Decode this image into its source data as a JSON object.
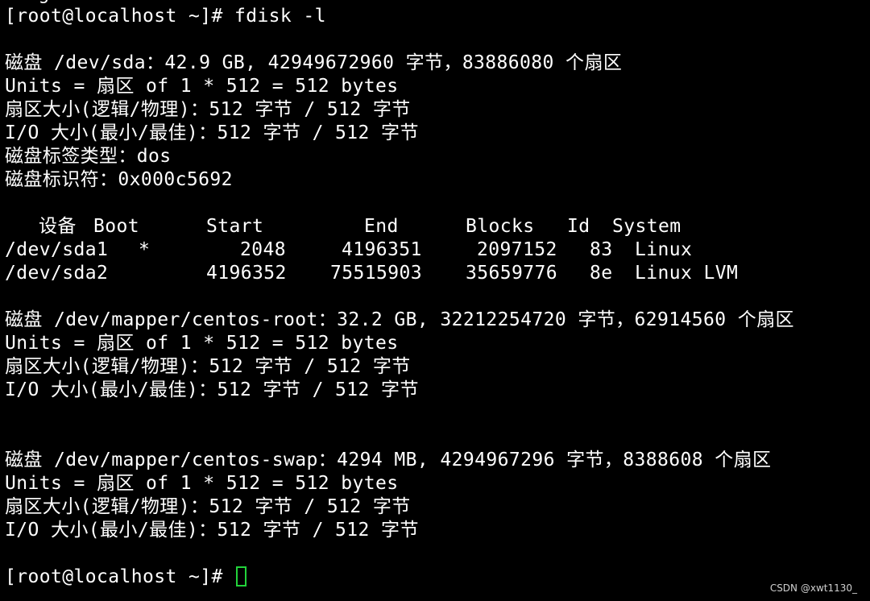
{
  "terminal": {
    "partial_top": "   g   ",
    "prompt_1": "[root@localhost ~]# fdisk -l",
    "sda": {
      "disk_line": "磁盘 /dev/sda：42.9 GB, 42949672960 字节，83886080 个扇区",
      "units": "Units = 扇区 of 1 * 512 = 512 bytes",
      "sector_size": "扇区大小(逻辑/物理)：512 字节 / 512 字节",
      "io_size": "I/O 大小(最小/最佳)：512 字节 / 512 字节",
      "label_type": "磁盘标签类型：dos",
      "identifier": "磁盘标识符：0x000c5692"
    },
    "partition_table": {
      "headers": [
        "设备",
        "Boot",
        "Start",
        "End",
        "Blocks",
        "Id",
        "System"
      ],
      "rows": [
        {
          "device": "/dev/sda1",
          "boot": "*",
          "start": "2048",
          "end": "4196351",
          "blocks": "2097152",
          "id": "83",
          "system": "Linux"
        },
        {
          "device": "/dev/sda2",
          "boot": "",
          "start": "4196352",
          "end": "75515903",
          "blocks": "35659776",
          "id": "8e",
          "system": "Linux LVM"
        }
      ]
    },
    "root": {
      "disk_line": "磁盘 /dev/mapper/centos-root：32.2 GB, 32212254720 字节，62914560 个扇区",
      "units": "Units = 扇区 of 1 * 512 = 512 bytes",
      "sector_size": "扇区大小(逻辑/物理)：512 字节 / 512 字节",
      "io_size": "I/O 大小(最小/最佳)：512 字节 / 512 字节"
    },
    "swap": {
      "disk_line": "磁盘 /dev/mapper/centos-swap：4294 MB, 4294967296 字节，8388608 个扇区",
      "units": "Units = 扇区 of 1 * 512 = 512 bytes",
      "sector_size": "扇区大小(逻辑/物理)：512 字节 / 512 字节",
      "io_size": "I/O 大小(最小/最佳)：512 字节 / 512 字节"
    },
    "prompt_2": "[root@localhost ~]# ",
    "cursor_color": "#22d33b",
    "background_color": "#000000",
    "text_color": "#ffffff"
  },
  "watermark": "CSDN @xwt1130_"
}
